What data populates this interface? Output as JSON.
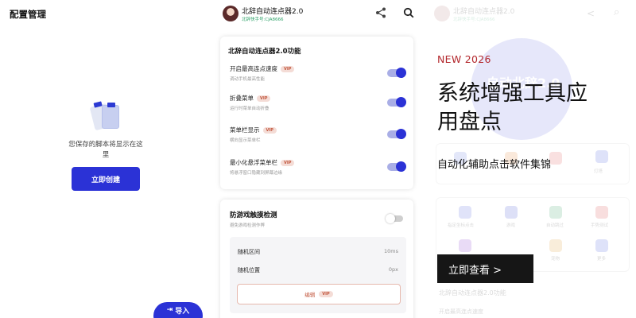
{
  "panel1": {
    "title": "配置管理",
    "empty_text": "您保存的脚本将显示在这里",
    "create_label": "立即创建",
    "import_icon": "import-icon",
    "import_label": "导入"
  },
  "panel2": {
    "app_name": "北辞自动连点器2.0",
    "app_sub": "北辞快手号:CJA8666",
    "card1_title": "北辞自动连点器2.0功能",
    "vip_label": "VIP",
    "features": [
      {
        "name": "开启最高连点速度",
        "desc": "调动手机最高性能",
        "on": true
      },
      {
        "name": "折叠菜单",
        "desc": "运行时菜单自动折叠",
        "on": true
      },
      {
        "name": "菜单栏显示",
        "desc": "横向显示菜单栏",
        "on": true
      },
      {
        "name": "最小化悬浮菜单栏",
        "desc": "将悬浮窗口隐藏到屏幕边缘",
        "on": true
      }
    ],
    "card2_title": "防游戏触摸检测",
    "card2_desc": "避免游戏检测作弊",
    "card2_on": false,
    "rows": [
      {
        "label": "随机区间",
        "value": "10ms"
      },
      {
        "label": "随机位置",
        "value": "0px"
      }
    ],
    "edit_label": "编辑"
  },
  "panel3": {
    "ghost": {
      "app_name": "北辞自动连点器2.0",
      "app_sub": "北辞快手号:CJA8666",
      "circle_text": "自动北辞2.0",
      "grid1": [
        "",
        "",
        "灯塔"
      ],
      "grid2": [
        "指定坐标点击",
        "游戏",
        "自动跳过",
        "手势测试"
      ],
      "grid3": [
        "",
        "宠物",
        "更多"
      ],
      "footer_title": "北辞自动连点器2.0功能",
      "footer_item": "开启最高连点速度"
    },
    "tag": "NEW 2026",
    "headline": "系统增强工具应用盘点",
    "subhead": "自动化辅助点击软件集锦",
    "cta": "立即查看 >"
  },
  "colors": {
    "accent": "#2b32d6",
    "vip_bg": "#f4dcd6",
    "vip_text": "#c2573e",
    "tag_red": "#b3282d",
    "cta_bg": "#161616"
  }
}
